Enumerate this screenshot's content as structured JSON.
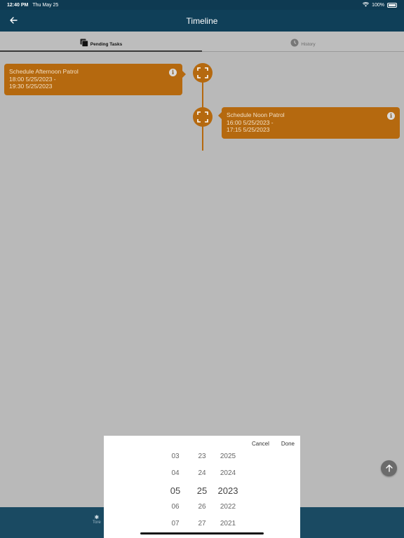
{
  "status_bar": {
    "time": "12:40 PM",
    "date": "Thu May 25",
    "battery": "100%",
    "wifi_icon": "wifi-icon",
    "battery_icon": "battery-icon"
  },
  "app_bar": {
    "title": "Timeline",
    "back_icon": "arrow-left-icon"
  },
  "tabs": [
    {
      "label": "Pending Tasks",
      "icon": "stack-icon",
      "active": true
    },
    {
      "label": "History",
      "icon": "clock-icon",
      "active": false
    }
  ],
  "timeline": {
    "items": [
      {
        "title": "Schedule Afternoon Patrol",
        "start": "18:00 5/25/2023 -",
        "end": "19:30 5/25/2023",
        "side": "left",
        "node_icon": "expand-icon",
        "info_icon": "info-icon"
      },
      {
        "title": "Schedule Noon Patrol",
        "start": "16:00 5/25/2023 -",
        "end": "17:15 5/25/2023",
        "side": "right",
        "node_icon": "expand-icon",
        "info_icon": "info-icon"
      }
    ],
    "accent_color": "#b5690f"
  },
  "bottom_nav": {
    "partial_label": "Tore"
  },
  "fab": {
    "icon": "arrow-up-icon"
  },
  "date_picker": {
    "cancel_label": "Cancel",
    "done_label": "Done",
    "month": [
      "03",
      "04",
      "05",
      "06",
      "07"
    ],
    "day": [
      "23",
      "24",
      "25",
      "26",
      "27"
    ],
    "year": [
      "2025",
      "2024",
      "2023",
      "2022",
      "2021"
    ],
    "selected_month": "05",
    "selected_day": "25",
    "selected_year": "2023"
  }
}
